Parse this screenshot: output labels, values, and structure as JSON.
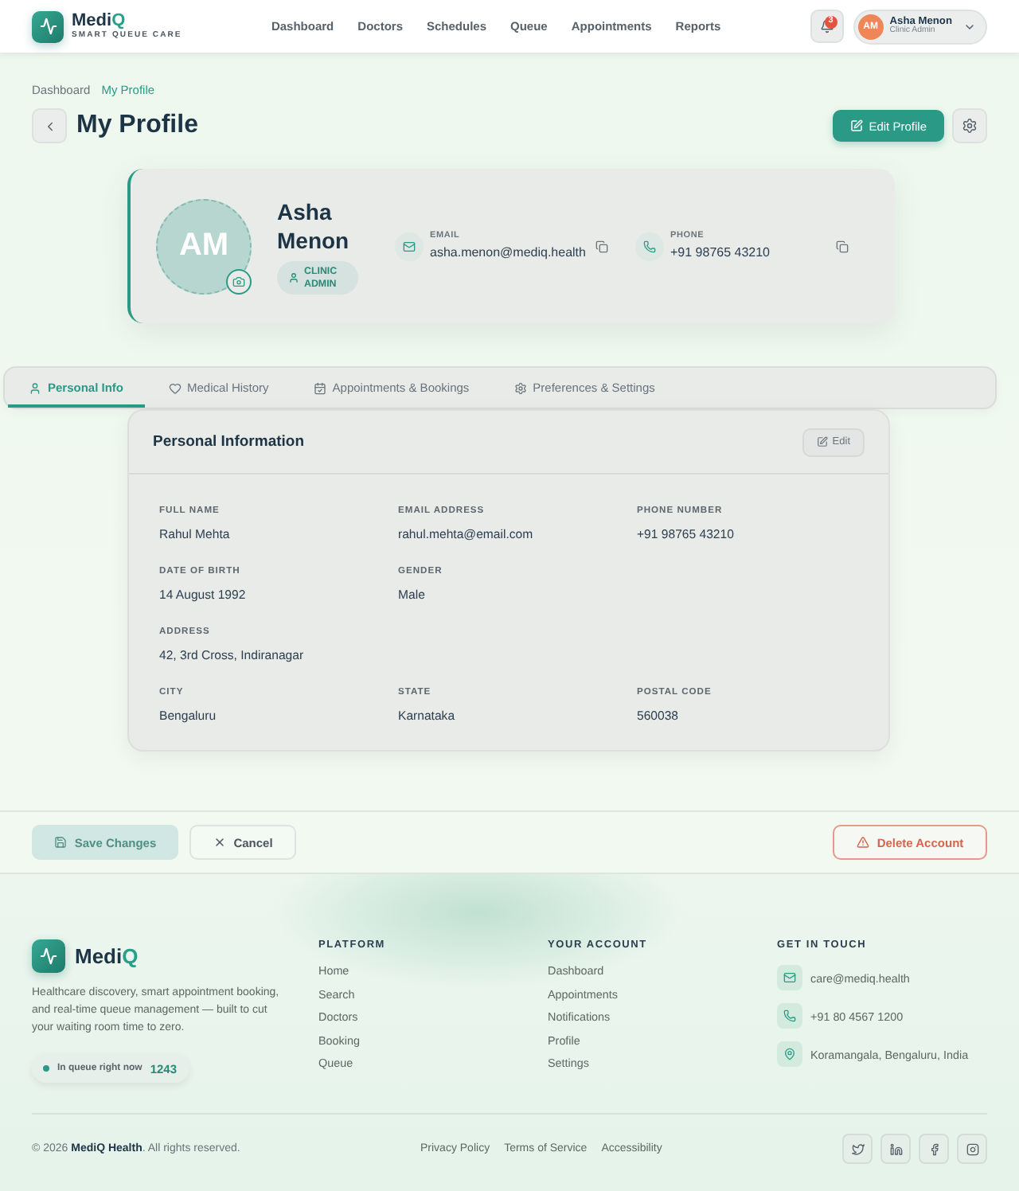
{
  "header": {
    "logo": {
      "name": "Medi",
      "accent": "Q",
      "tagline": "SMART QUEUE CARE"
    },
    "nav": [
      "Dashboard",
      "Doctors",
      "Schedules",
      "Queue",
      "Appointments",
      "Reports"
    ],
    "notifications": {
      "count": "3"
    },
    "user": {
      "initials": "AM",
      "name": "Asha Menon",
      "role": "Clinic Admin"
    }
  },
  "breadcrumb": [
    {
      "label": "Dashboard",
      "current": false
    },
    {
      "label": "My Profile",
      "current": true
    }
  ],
  "page": {
    "title": "My Profile",
    "edit_button": "Edit Profile"
  },
  "profile": {
    "initials": "AM",
    "name": "Asha Menon",
    "role": "CLINIC ADMIN",
    "contacts": [
      {
        "kind": "email",
        "label": "EMAIL",
        "value": "asha.menon@mediq.health"
      },
      {
        "kind": "phone",
        "label": "PHONE",
        "value": "+91 98765 43210"
      }
    ]
  },
  "tabs": [
    {
      "label": "Personal Info",
      "selected": true
    },
    {
      "label": "Medical History",
      "selected": false
    },
    {
      "label": "Appointments & Bookings",
      "selected": false
    },
    {
      "label": "Preferences & Settings",
      "selected": false
    }
  ],
  "personal_information": {
    "title": "Personal Information",
    "edit_button": "Edit",
    "rows": [
      {
        "fields": [
          {
            "label": "FULL NAME",
            "value": "Rahul Mehta"
          },
          {
            "label": "EMAIL ADDRESS",
            "value": "rahul.mehta@email.com"
          },
          {
            "label": "PHONE NUMBER",
            "value": "+91 98765 43210"
          }
        ]
      },
      {
        "fields": [
          {
            "label": "DATE OF BIRTH",
            "value": "14 August 1992"
          },
          {
            "label": "GENDER",
            "value": "Male"
          }
        ]
      },
      {
        "fields": [
          {
            "label": "ADDRESS",
            "value": "42, 3rd Cross, Indiranagar"
          }
        ]
      },
      {
        "fields": [
          {
            "label": "CITY",
            "value": "Bengaluru"
          },
          {
            "label": "STATE",
            "value": "Karnataka"
          },
          {
            "label": "POSTAL CODE",
            "value": "560038"
          }
        ]
      }
    ]
  },
  "actions": {
    "save": {
      "label": "Save Changes",
      "disabled": true
    },
    "cancel": "Cancel",
    "delete": "Delete Account"
  },
  "footer": {
    "logo": {
      "name": "Medi",
      "accent": "Q"
    },
    "description": "Healthcare discovery, smart appointment booking, and real-time queue management — built to cut your waiting room time to zero.",
    "queue": {
      "label": "In queue right now",
      "count": "1243"
    },
    "columns": [
      {
        "title": "PLATFORM",
        "links": [
          "Home",
          "Search",
          "Doctors",
          "Booking",
          "Queue"
        ]
      },
      {
        "title": "YOUR ACCOUNT",
        "links": [
          "Dashboard",
          "Appointments",
          "Notifications",
          "Profile",
          "Settings"
        ]
      }
    ],
    "contact": {
      "title": "GET IN TOUCH",
      "items": [
        {
          "kind": "email",
          "text": "care@mediq.health"
        },
        {
          "kind": "phone",
          "text": "+91 80 4567 1200"
        },
        {
          "kind": "address",
          "text": "Koramangala, Bengaluru, India"
        }
      ]
    },
    "copyright": "© 2026 **MediQ Health**. All rights reserved.",
    "legal_links": [
      "Privacy Policy",
      "Terms of Service",
      "Accessibility"
    ]
  }
}
